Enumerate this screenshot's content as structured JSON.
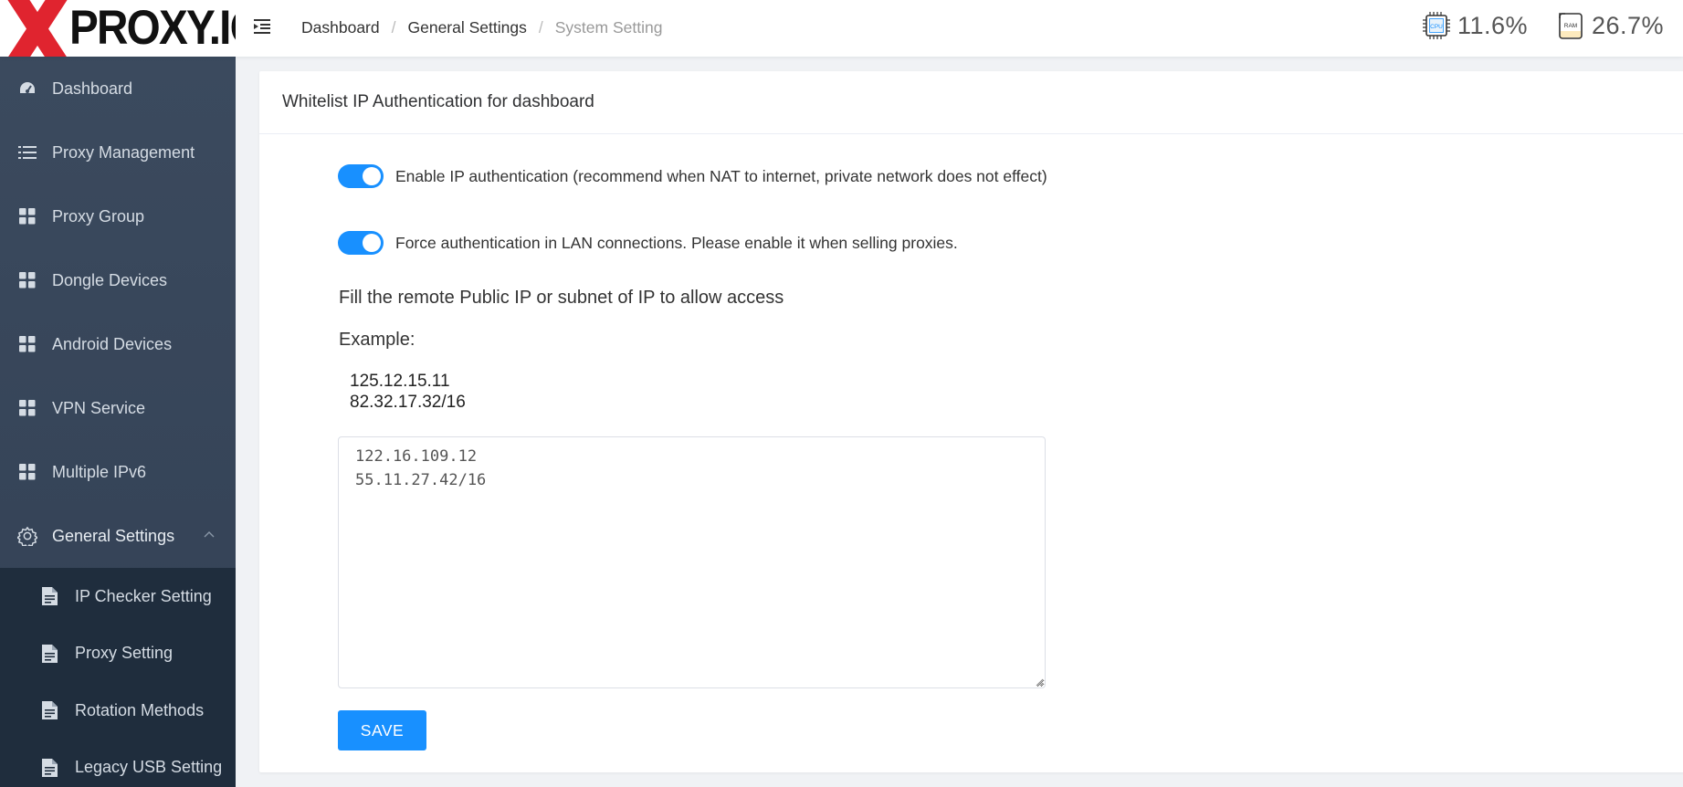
{
  "brand": {
    "name": "PROXY.IO",
    "logo_colors": {
      "accent": "#e0242f"
    }
  },
  "header": {
    "menu_icon": "menu-fold-icon",
    "breadcrumb": [
      "Dashboard",
      "General Settings",
      "System Setting"
    ],
    "cpu": {
      "icon": "cpu-chip-icon",
      "chip_label": "CPU",
      "value": "11.6%"
    },
    "ram": {
      "icon": "ram-chip-icon",
      "chip_label": "RAM",
      "value": "26.7%"
    }
  },
  "sidebar": {
    "items": [
      {
        "label": "Dashboard",
        "icon": "dashboard-gauge-icon"
      },
      {
        "label": "Proxy Management",
        "icon": "list-icon"
      },
      {
        "label": "Proxy Group",
        "icon": "grid-icon"
      },
      {
        "label": "Dongle Devices",
        "icon": "grid-icon"
      },
      {
        "label": "Android Devices",
        "icon": "grid-icon"
      },
      {
        "label": "VPN Service",
        "icon": "grid-icon"
      },
      {
        "label": "Multiple IPv6",
        "icon": "grid-icon"
      },
      {
        "label": "General Settings",
        "icon": "gear-icon",
        "expanded": true
      }
    ],
    "submenu": [
      {
        "label": "IP Checker Setting",
        "icon": "document-icon"
      },
      {
        "label": "Proxy Setting",
        "icon": "document-icon"
      },
      {
        "label": "Rotation Methods",
        "icon": "document-icon"
      },
      {
        "label": "Legacy USB Setting",
        "icon": "document-icon"
      }
    ]
  },
  "card": {
    "title": "Whitelist IP Authentication for dashboard",
    "switch_ip_auth": {
      "label": "Enable IP authentication (recommend when NAT to internet, private network does not effect)",
      "on": true
    },
    "switch_force_lan": {
      "label": "Force authentication in LAN connections. Please enable it when selling proxies.",
      "on": true
    },
    "instruction": "Fill the remote Public IP or subnet of IP to allow access",
    "example_label": "Example:",
    "example_lines": [
      "125.12.15.11",
      "82.32.17.32/16"
    ],
    "whitelist_value": "122.16.109.12\n55.11.27.42/16",
    "save_label": "SAVE"
  },
  "colors": {
    "primary": "#1890ff",
    "sidebar_bg": "#364457",
    "submenu_bg": "#1f2d3d"
  }
}
